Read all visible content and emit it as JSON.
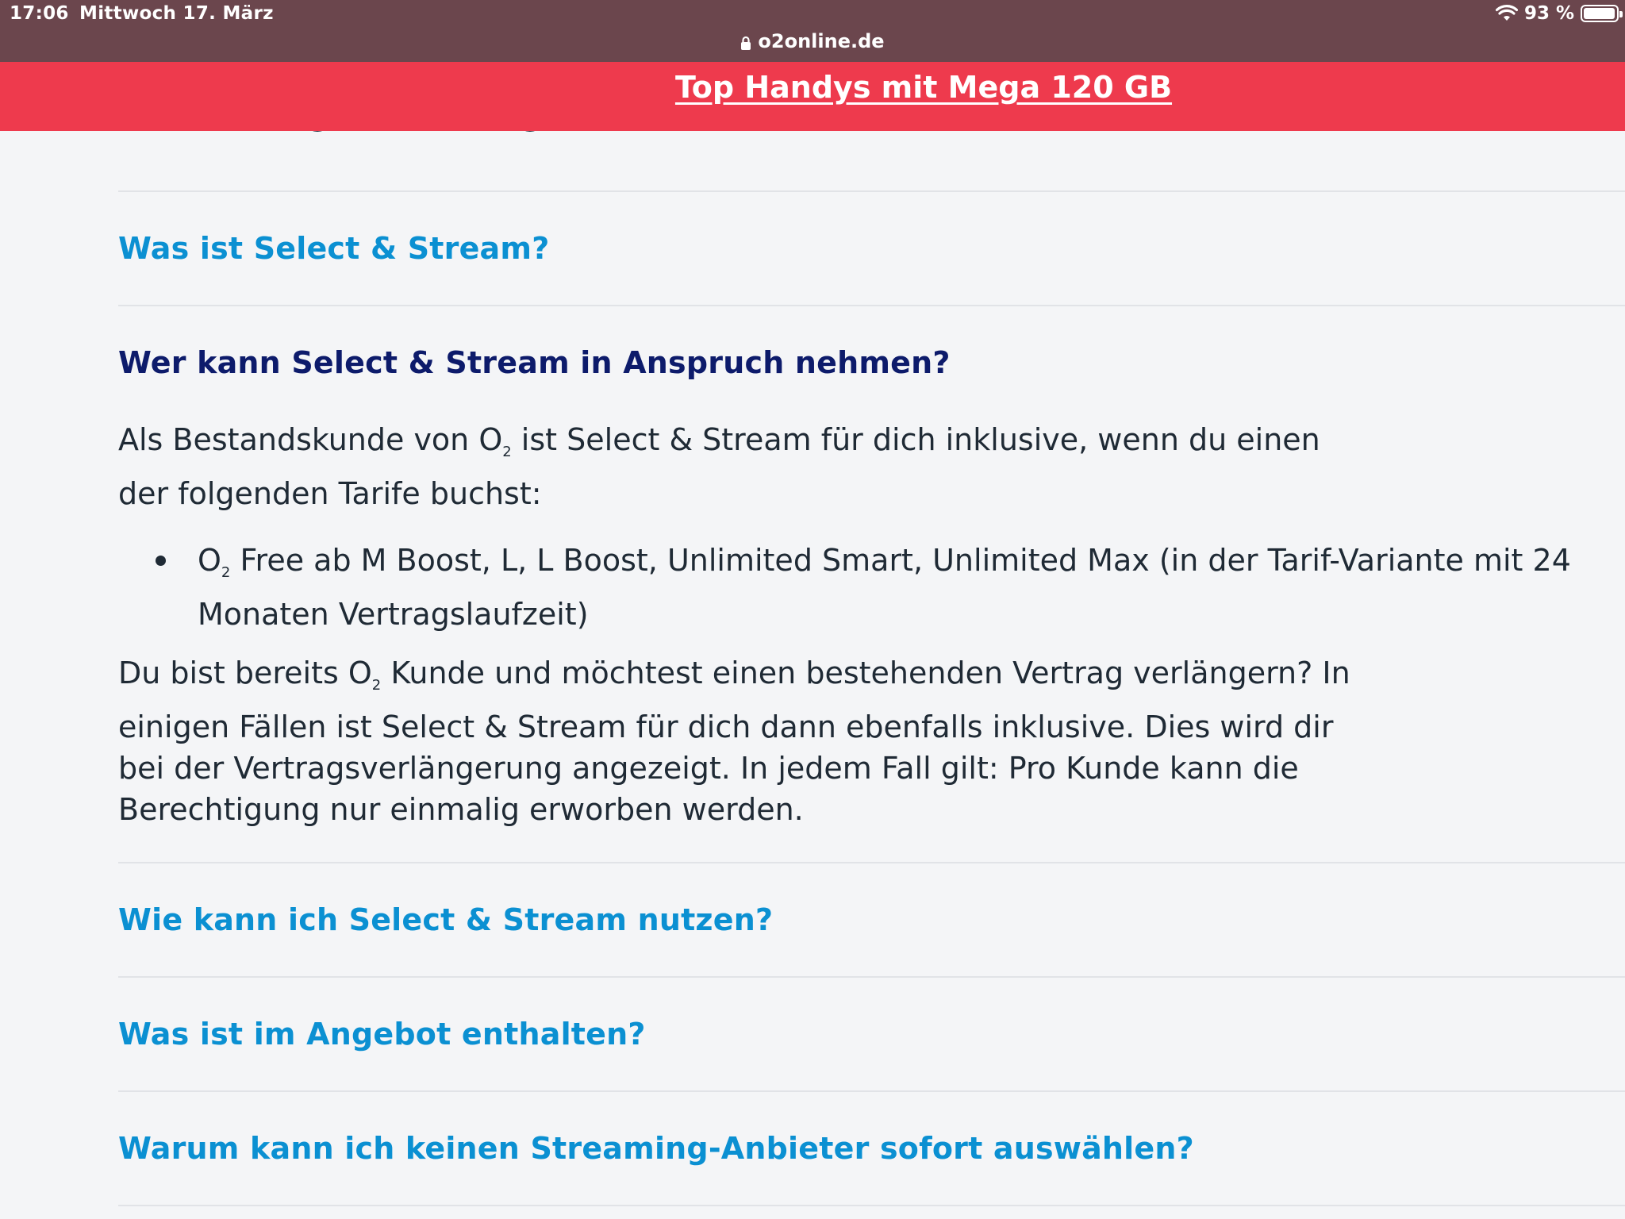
{
  "status_bar": {
    "time": "17:06",
    "date": "Mittwoch 17. März",
    "battery": "93 %"
  },
  "browser": {
    "url": "o2online.de"
  },
  "promo": {
    "link_text": "Top Handys mit Mega 120 GB"
  },
  "faq": {
    "q1": "Was ist Select & Stream?",
    "q2": "Wer kann Select & Stream in Anspruch nehmen?",
    "a2": {
      "p1_pre": "Als Bestandskunde von O",
      "p1_post": " ist Select & Stream für dich inklusive, wenn du einen der folgenden Tarife buchst:",
      "bullet_pre": "O",
      "bullet_post": " Free ab M Boost, L, L Boost, Unlimited Smart, Unlimited Max (in der Tarif-Variante mit 24 Monaten Vertragslaufzeit)",
      "p2_pre": "Du bist bereits O",
      "p2_post": " Kunde und möchtest einen bestehenden Vertrag verlängern? In einigen Fällen ist Select & Stream für dich dann ebenfalls inklusive. Dies wird dir bei der Vertragsverlängerung angezeigt. In jedem Fall gilt: Pro Kunde kann die Berechtigung nur einmalig erworben werden.",
      "subscript": "2"
    },
    "q3": "Wie kann ich Select & Stream nutzen?",
    "q4": "Was ist im Angebot enthalten?",
    "q5": "Warum kann ich keinen Streaming-Anbieter sofort auswählen?"
  },
  "colors": {
    "chrome_bg": "#6b464d",
    "promo_bg": "#ee3a4d",
    "link_blue": "#0b90d2",
    "open_question": "#0d1b6b",
    "page_bg": "#f4f5f7"
  }
}
